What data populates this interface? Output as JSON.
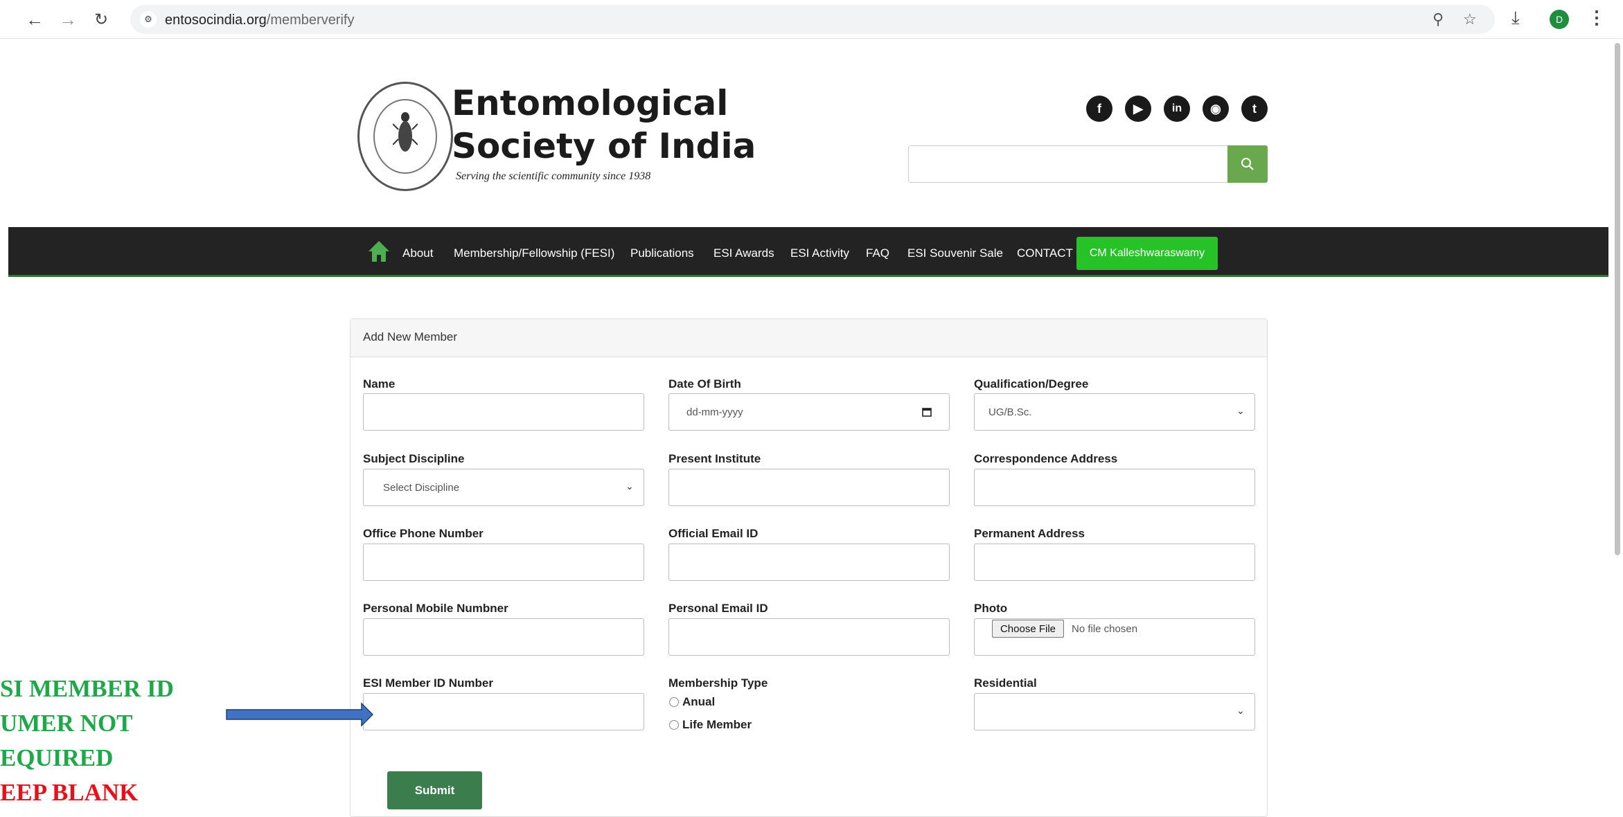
{
  "browser": {
    "url_domain": "entosocindia.org",
    "url_path": "/memberverify",
    "profile_initial": "D",
    "icons": [
      "back-icon",
      "forward-icon",
      "reload-icon",
      "site-info-icon",
      "zoom-icon",
      "bookmark-star-icon",
      "download-icon",
      "more-menu-icon"
    ]
  },
  "header": {
    "title_line1": "Entomological",
    "title_line2": "Society of India",
    "tagline": "Serving the scientific community since 1938",
    "social": [
      "facebook-icon",
      "youtube-icon",
      "linkedin-icon",
      "instagram-icon",
      "twitter-icon"
    ],
    "search_button_color": "#6aa84f"
  },
  "nav": {
    "items": [
      "About",
      "Membership/Fellowship (FESI)",
      "Publications",
      "ESI Awards",
      "ESI Activity",
      "FAQ",
      "ESI Souvenir Sale",
      "CONTACT"
    ],
    "highlight": "CM Kalleshwaraswamy",
    "highlight_color": "#27c227"
  },
  "form": {
    "title": "Add New Member",
    "fields": {
      "name": {
        "label": "Name",
        "value": ""
      },
      "dob": {
        "label": "Date Of Birth",
        "placeholder": "dd-mm-yyyy"
      },
      "qualification": {
        "label": "Qualification/Degree",
        "selected": "UG/B.Sc."
      },
      "subject": {
        "label": "Subject Discipline",
        "selected": "Select Discipline"
      },
      "institute": {
        "label": "Present Institute",
        "value": ""
      },
      "corr_address": {
        "label": "Correspondence Address",
        "value": ""
      },
      "office_phone": {
        "label": "Office Phone Number",
        "value": ""
      },
      "official_email": {
        "label": "Official Email ID",
        "value": ""
      },
      "perm_address": {
        "label": "Permanent Address",
        "value": ""
      },
      "mobile": {
        "label": "Personal Mobile Numbner",
        "value": ""
      },
      "personal_email": {
        "label": "Personal Email ID",
        "value": ""
      },
      "photo": {
        "label": "Photo",
        "button": "Choose File",
        "status": "No file chosen"
      },
      "member_id": {
        "label": "ESI Member ID Number",
        "value": ""
      },
      "membership_type": {
        "label": "Membership Type",
        "options": [
          "Anual",
          "Life Member"
        ]
      },
      "residential": {
        "label": "Residential",
        "selected": ""
      }
    },
    "submit": "Submit"
  },
  "annotation": {
    "lines_green": [
      "SI MEMBER ID",
      "UMER NOT",
      "EQUIRED"
    ],
    "line_red": "EEP BLANK",
    "green": "#1ea84a",
    "red": "#e8101b",
    "arrow_color": "#3f72c0"
  }
}
